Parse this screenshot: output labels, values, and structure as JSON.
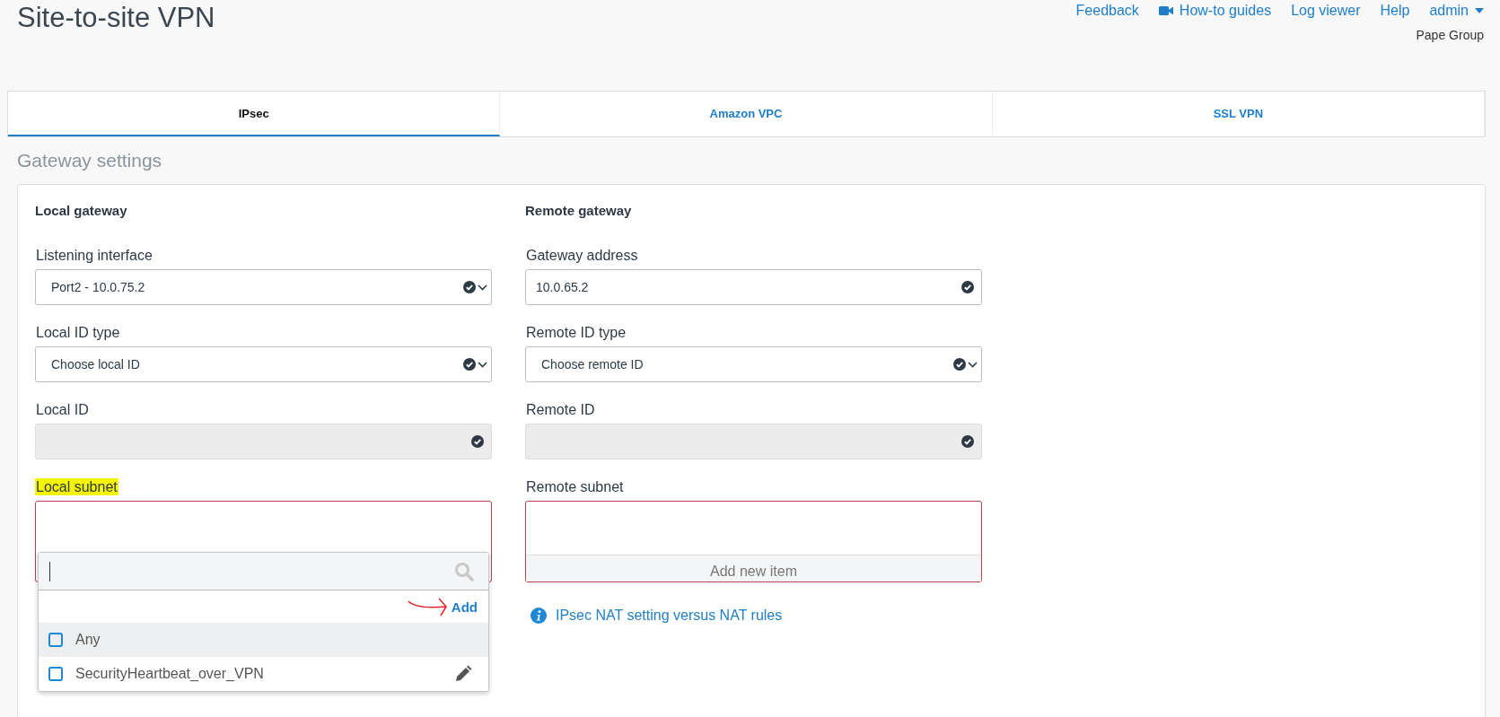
{
  "page": {
    "title": "Site-to-site VPN"
  },
  "nav": {
    "links": [
      {
        "label": "Feedback",
        "kind": "link"
      },
      {
        "label": "How-to guides",
        "kind": "video"
      },
      {
        "label": "Log viewer",
        "kind": "link"
      },
      {
        "label": "Help",
        "kind": "link"
      },
      {
        "label": "admin",
        "kind": "menu"
      }
    ],
    "organization": "Pape Group"
  },
  "tabs": [
    {
      "label": "IPsec",
      "selected": true
    },
    {
      "label": "Amazon VPC",
      "selected": false
    },
    {
      "label": "SSL VPN",
      "selected": false
    }
  ],
  "section_title": "Gateway settings",
  "columns": [
    {
      "heading": "Local gateway",
      "fields": [
        {
          "label": "Listening interface",
          "kind": "select",
          "value": "Port2 - 10.0.75.2",
          "highlighted": false
        },
        {
          "label": "Local ID type",
          "kind": "select",
          "value": "Choose local ID",
          "highlighted": false
        },
        {
          "label": "Local ID",
          "kind": "disabled",
          "highlighted": false
        },
        {
          "label": "Local subnet",
          "kind": "subnet",
          "highlighted": true,
          "dropdown": {
            "add": "Add",
            "options": [
              {
                "label": "Any",
                "checked": false,
                "hovered": true,
                "editable": false
              },
              {
                "label": "SecurityHeartbeat_over_VPN",
                "checked": false,
                "hovered": false,
                "editable": true
              }
            ]
          }
        }
      ]
    },
    {
      "heading": "Remote gateway",
      "fields": [
        {
          "label": "Gateway address",
          "kind": "text",
          "value": "10.0.65.2",
          "highlighted": false
        },
        {
          "label": "Remote ID type",
          "kind": "select",
          "value": "Choose remote ID",
          "highlighted": false
        },
        {
          "label": "Remote ID",
          "kind": "disabled",
          "highlighted": false
        },
        {
          "label": "Remote subnet",
          "kind": "subnet",
          "highlighted": false,
          "add_item": "Add new item"
        }
      ],
      "info_link": "IPsec NAT setting versus NAT rules"
    }
  ]
}
